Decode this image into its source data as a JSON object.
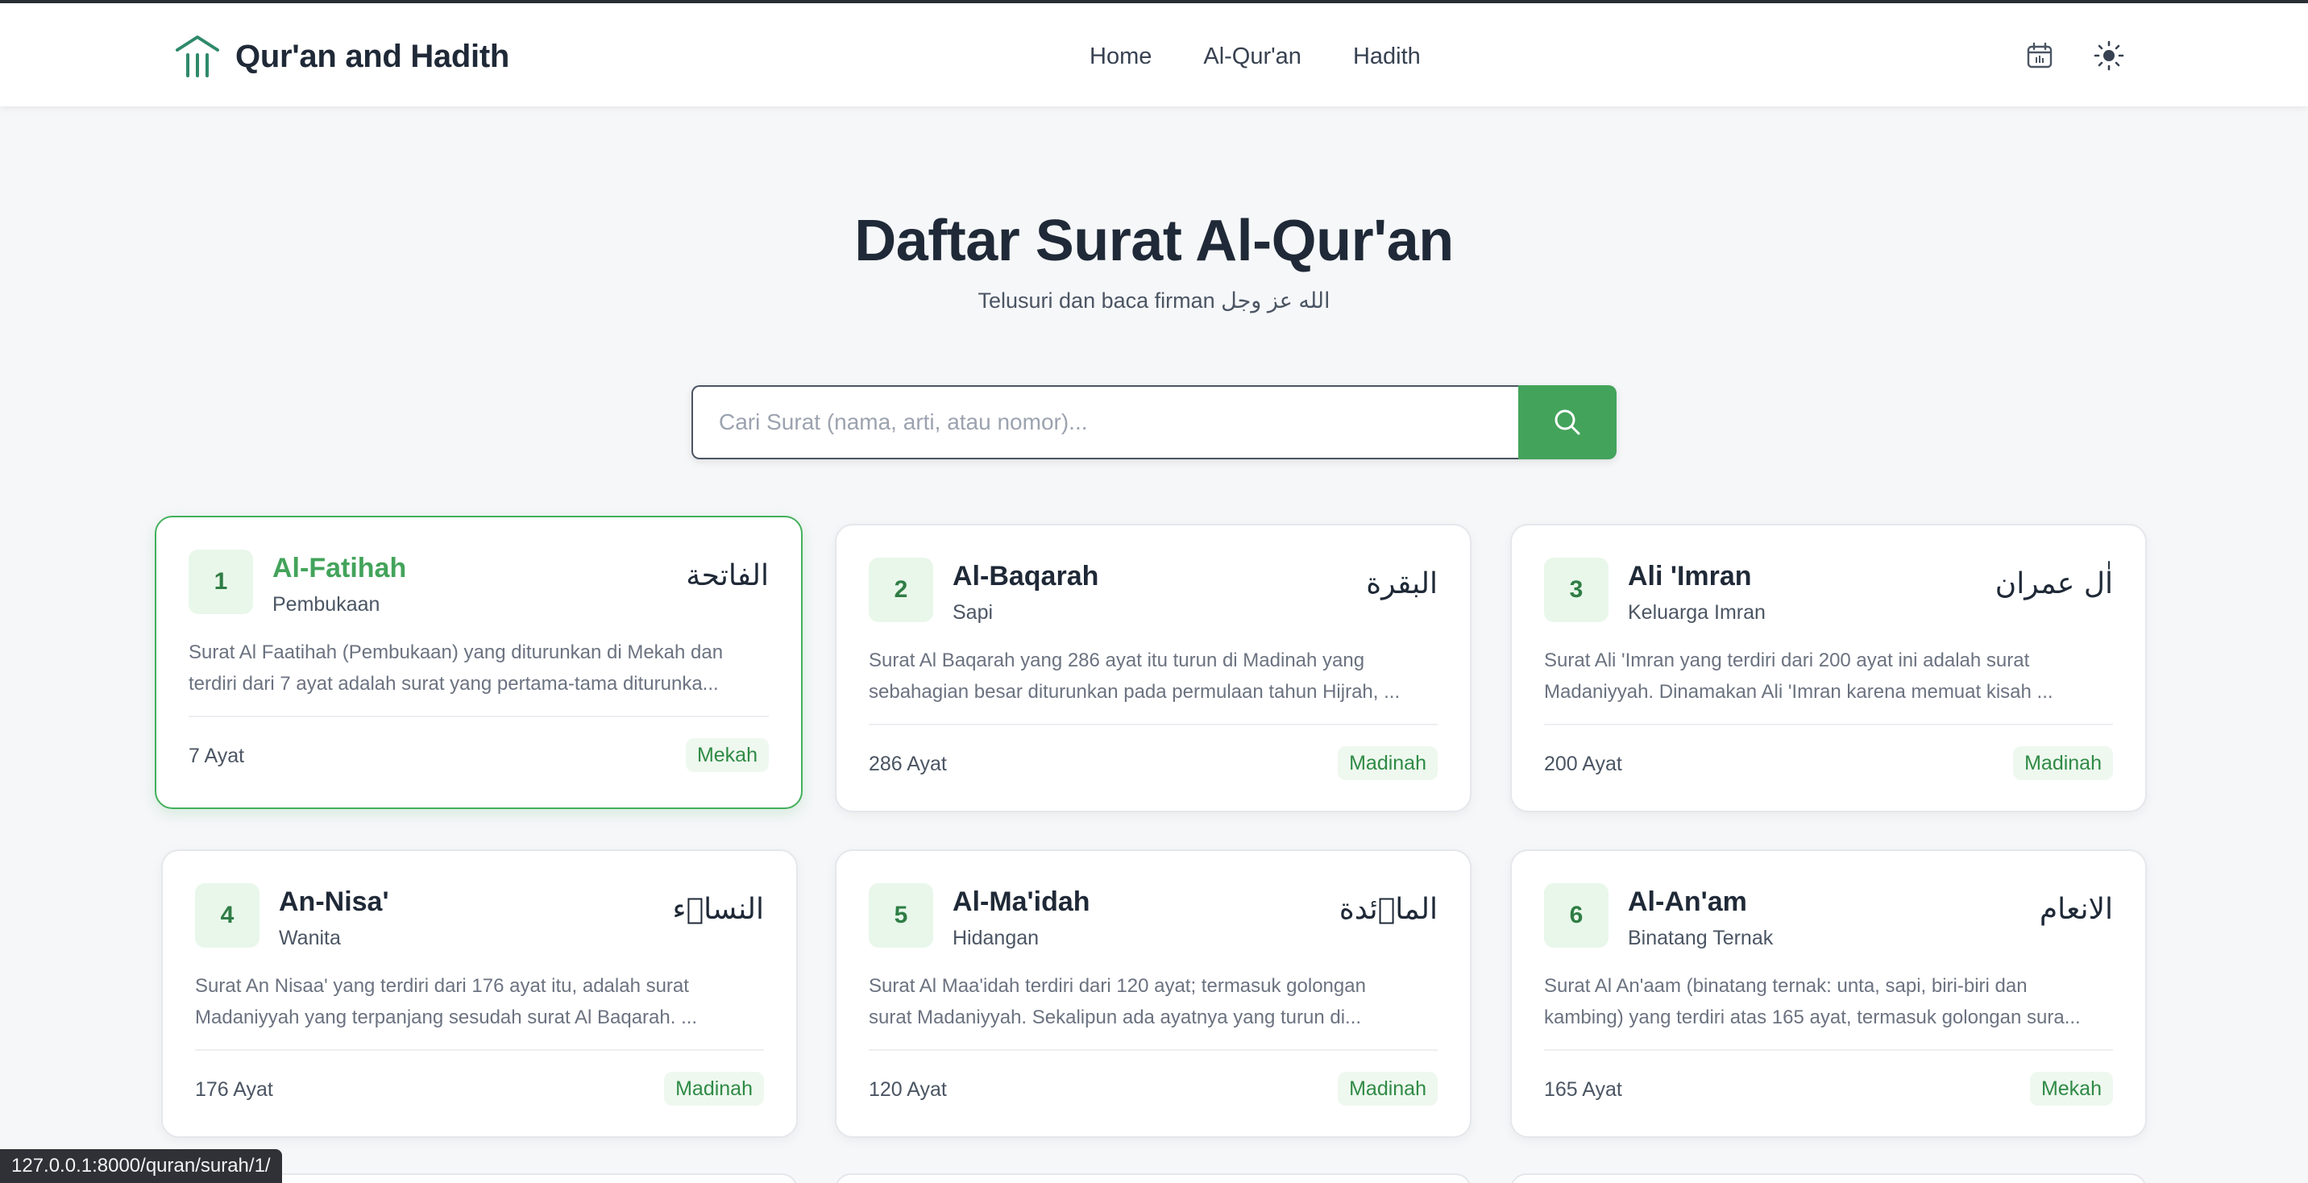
{
  "app": {
    "title": "Qur'an and Hadith"
  },
  "nav": [
    {
      "label": "Home"
    },
    {
      "label": "Al-Qur'an"
    },
    {
      "label": "Hadith"
    }
  ],
  "header_icons": [
    "calendar-icon",
    "sun-icon"
  ],
  "hero": {
    "title": "Daftar Surat Al-Qur'an",
    "subtitle": "Telusuri dan baca firman الله عز وجل"
  },
  "search": {
    "placeholder": "Cari Surat (nama, arti, atau nomor)...",
    "value": ""
  },
  "colors": {
    "accent": "#43a35b",
    "badge_bg": "#e8f7ea",
    "active_border": "#43b05c"
  },
  "surahs": [
    {
      "number": "1",
      "name": "Al-Fatihah",
      "meaning": "Pembukaan",
      "arabic": "الفاتحة",
      "desc_line1": "Surat Al Faatihah (Pembukaan) yang diturunkan di Mekah dan",
      "desc_line2": "terdiri dari 7 ayat adalah surat yang pertama-tama diturunka...",
      "ayat": "7 Ayat",
      "place": "Mekah"
    },
    {
      "number": "2",
      "name": "Al-Baqarah",
      "meaning": "Sapi",
      "arabic": "البقرة",
      "desc_line1": "Surat Al Baqarah yang 286 ayat itu turun di Madinah yang",
      "desc_line2": "sebahagian besar diturunkan pada permulaan tahun Hijrah, ...",
      "ayat": "286 Ayat",
      "place": "Madinah"
    },
    {
      "number": "3",
      "name": "Ali 'Imran",
      "meaning": "Keluarga Imran",
      "arabic": "اٰل عمران",
      "desc_line1": "Surat Ali 'Imran yang terdiri dari 200 ayat ini adalah surat",
      "desc_line2": "Madaniyyah. Dinamakan Ali 'Imran karena memuat kisah ...",
      "ayat": "200 Ayat",
      "place": "Madinah"
    },
    {
      "number": "4",
      "name": "An-Nisa'",
      "meaning": "Wanita",
      "arabic": "النساۤء",
      "desc_line1": "Surat An Nisaa' yang terdiri dari 176 ayat itu, adalah surat",
      "desc_line2": "Madaniyyah yang terpanjang sesudah surat Al Baqarah. ...",
      "ayat": "176 Ayat",
      "place": "Madinah"
    },
    {
      "number": "5",
      "name": "Al-Ma'idah",
      "meaning": "Hidangan",
      "arabic": "الماۤئدة",
      "desc_line1": "Surat Al Maa'idah terdiri dari 120 ayat; termasuk golongan",
      "desc_line2": "surat Madaniyyah. Sekalipun ada ayatnya yang turun di...",
      "ayat": "120 Ayat",
      "place": "Madinah"
    },
    {
      "number": "6",
      "name": "Al-An'am",
      "meaning": "Binatang Ternak",
      "arabic": "الانعام",
      "desc_line1": "Surat Al An'aam (binatang ternak: unta, sapi, biri-biri dan",
      "desc_line2": "kambing) yang terdiri atas 165 ayat, termasuk golongan sura...",
      "ayat": "165 Ayat",
      "place": "Mekah"
    }
  ],
  "statusbar": {
    "url": "127.0.0.1:8000/quran/surah/1/"
  }
}
